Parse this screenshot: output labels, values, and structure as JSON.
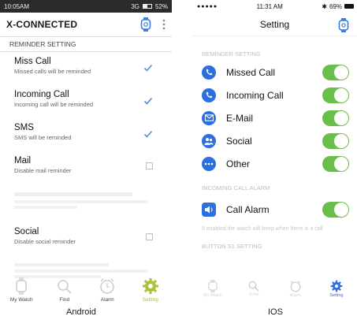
{
  "android": {
    "status": {
      "time": "10:05AM",
      "network": "3G",
      "battery": "52%"
    },
    "header": {
      "title": "X-CONNECTED"
    },
    "section_label": "REMINDER SETTING",
    "items": [
      {
        "title": "Miss Call",
        "subtitle": "Missed calls will be reminded",
        "checked": true
      },
      {
        "title": "Incoming Call",
        "subtitle": "Incoming call will be reminded",
        "checked": true
      },
      {
        "title": "SMS",
        "subtitle": "SMS will be reminded",
        "checked": true
      },
      {
        "title": "Mail",
        "subtitle": "Disable mail reminder",
        "checked": false
      },
      {
        "title": "Social",
        "subtitle": "Disable social reminder",
        "checked": false
      }
    ],
    "tabs": [
      {
        "label": "My Watch",
        "icon": "watch-icon"
      },
      {
        "label": "Find",
        "icon": "search-icon"
      },
      {
        "label": "Alarm",
        "icon": "alarm-clock-icon"
      },
      {
        "label": "Setting",
        "icon": "gear-icon",
        "active": true
      }
    ],
    "caption": "Android"
  },
  "ios": {
    "status": {
      "time": "11:31 AM",
      "battery": "69%"
    },
    "nav": {
      "title": "Setting"
    },
    "sections": {
      "reminder": "REMINDER SETTING",
      "incoming_alarm": "INCOMING CALL ALARM",
      "button": "BUTTON S1 SETTING"
    },
    "rows": [
      {
        "label": "Missed Call",
        "icon": "missed-call-icon",
        "on": true
      },
      {
        "label": "Incoming Call",
        "icon": "incoming-call-icon",
        "on": true
      },
      {
        "label": "E-Mail",
        "icon": "mail-icon",
        "on": true
      },
      {
        "label": "Social",
        "icon": "social-icon",
        "on": true
      },
      {
        "label": "Other",
        "icon": "more-icon",
        "on": true
      }
    ],
    "alarm_row": {
      "label": "Call Alarm",
      "icon": "speaker-icon",
      "on": true
    },
    "alarm_note": "If enabled,the watch will beep when there is a call",
    "tabs": [
      {
        "label": "My Watch",
        "icon": "watch-icon"
      },
      {
        "label": "Find",
        "icon": "search-icon"
      },
      {
        "label": "Alarm",
        "icon": "alarm-clock-icon"
      },
      {
        "label": "Setting",
        "icon": "gear-icon",
        "active": true
      }
    ],
    "caption": "IOS"
  },
  "colors": {
    "accent_green": "#6abf4b",
    "android_active": "#a7c53a",
    "ios_blue": "#2d6fde",
    "check_blue": "#4a90e2"
  }
}
